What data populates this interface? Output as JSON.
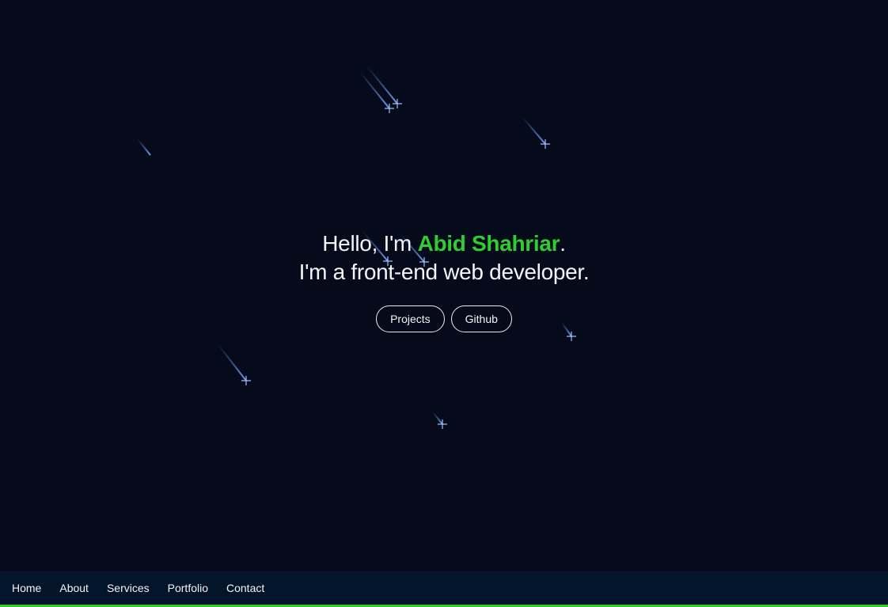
{
  "hero": {
    "greeting": "Hello, I'm ",
    "name": "Abid Shahriar",
    "greeting_end": ".",
    "tagline": "I'm a front-end web developer."
  },
  "buttons": {
    "projects_label": "Projects",
    "github_label": "Github"
  },
  "nav": {
    "items": [
      {
        "label": "Home"
      },
      {
        "label": "About"
      },
      {
        "label": "Services"
      },
      {
        "label": "Portfolio"
      },
      {
        "label": "Contact"
      }
    ]
  },
  "colors": {
    "background": "#050b1b",
    "accent": "#2fcc34",
    "navbar": "#03152a",
    "star": "#5b8cff"
  },
  "decor": {
    "star_icon": "shooting-star-icon"
  }
}
